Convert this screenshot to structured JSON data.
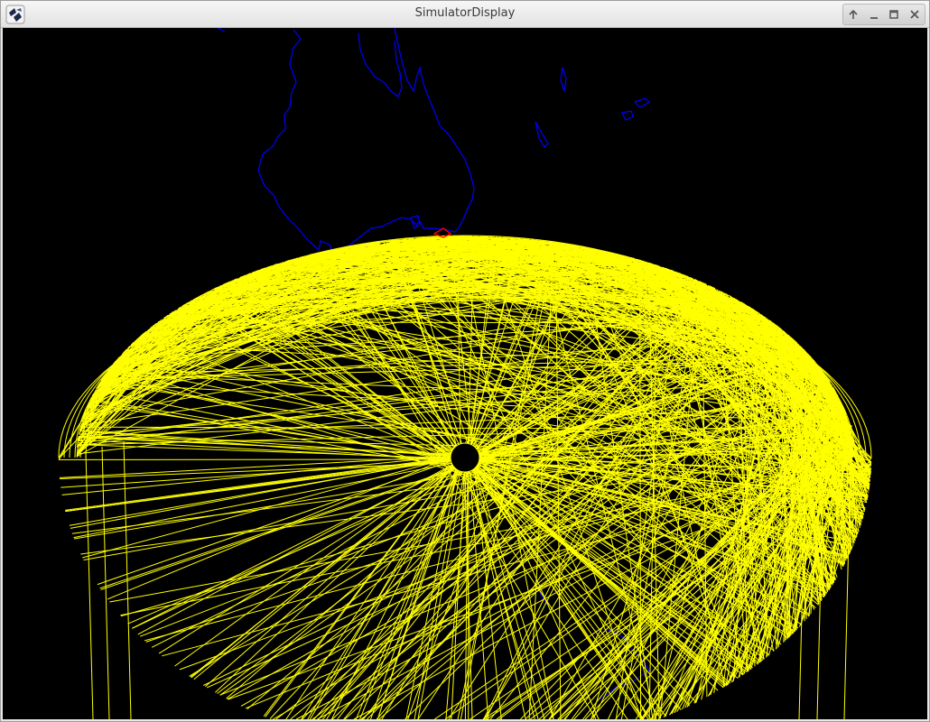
{
  "window": {
    "title": "SimulatorDisplay",
    "controls": [
      {
        "name": "pin-button",
        "icon": "arrow-up-icon"
      },
      {
        "name": "minimize-button",
        "icon": "minimize-icon"
      },
      {
        "name": "maximize-button",
        "icon": "maximize-icon"
      },
      {
        "name": "close-button",
        "icon": "close-icon"
      }
    ]
  },
  "colors": {
    "background": "#000000",
    "coastline": "#0000ff",
    "orbit_tracks": "#ffff00",
    "marker": "#ff0000"
  }
}
